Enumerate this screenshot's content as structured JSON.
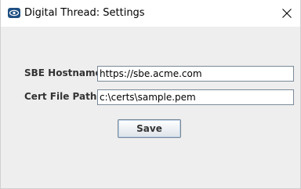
{
  "window": {
    "title": "Digital Thread: Settings",
    "icon": "eye-icon",
    "close_icon": "close-icon"
  },
  "form": {
    "hostname_label": "SBE Hostname :",
    "hostname_value": "https://sbe.acme.com",
    "certpath_label": "Cert File Path :",
    "certpath_value": "c:\\certs\\sample.pem",
    "save_label": "Save"
  },
  "colors": {
    "app_icon_bg": "#1f4f82",
    "window_bg": "#eeeeee",
    "field_border": "#7a8a99"
  }
}
